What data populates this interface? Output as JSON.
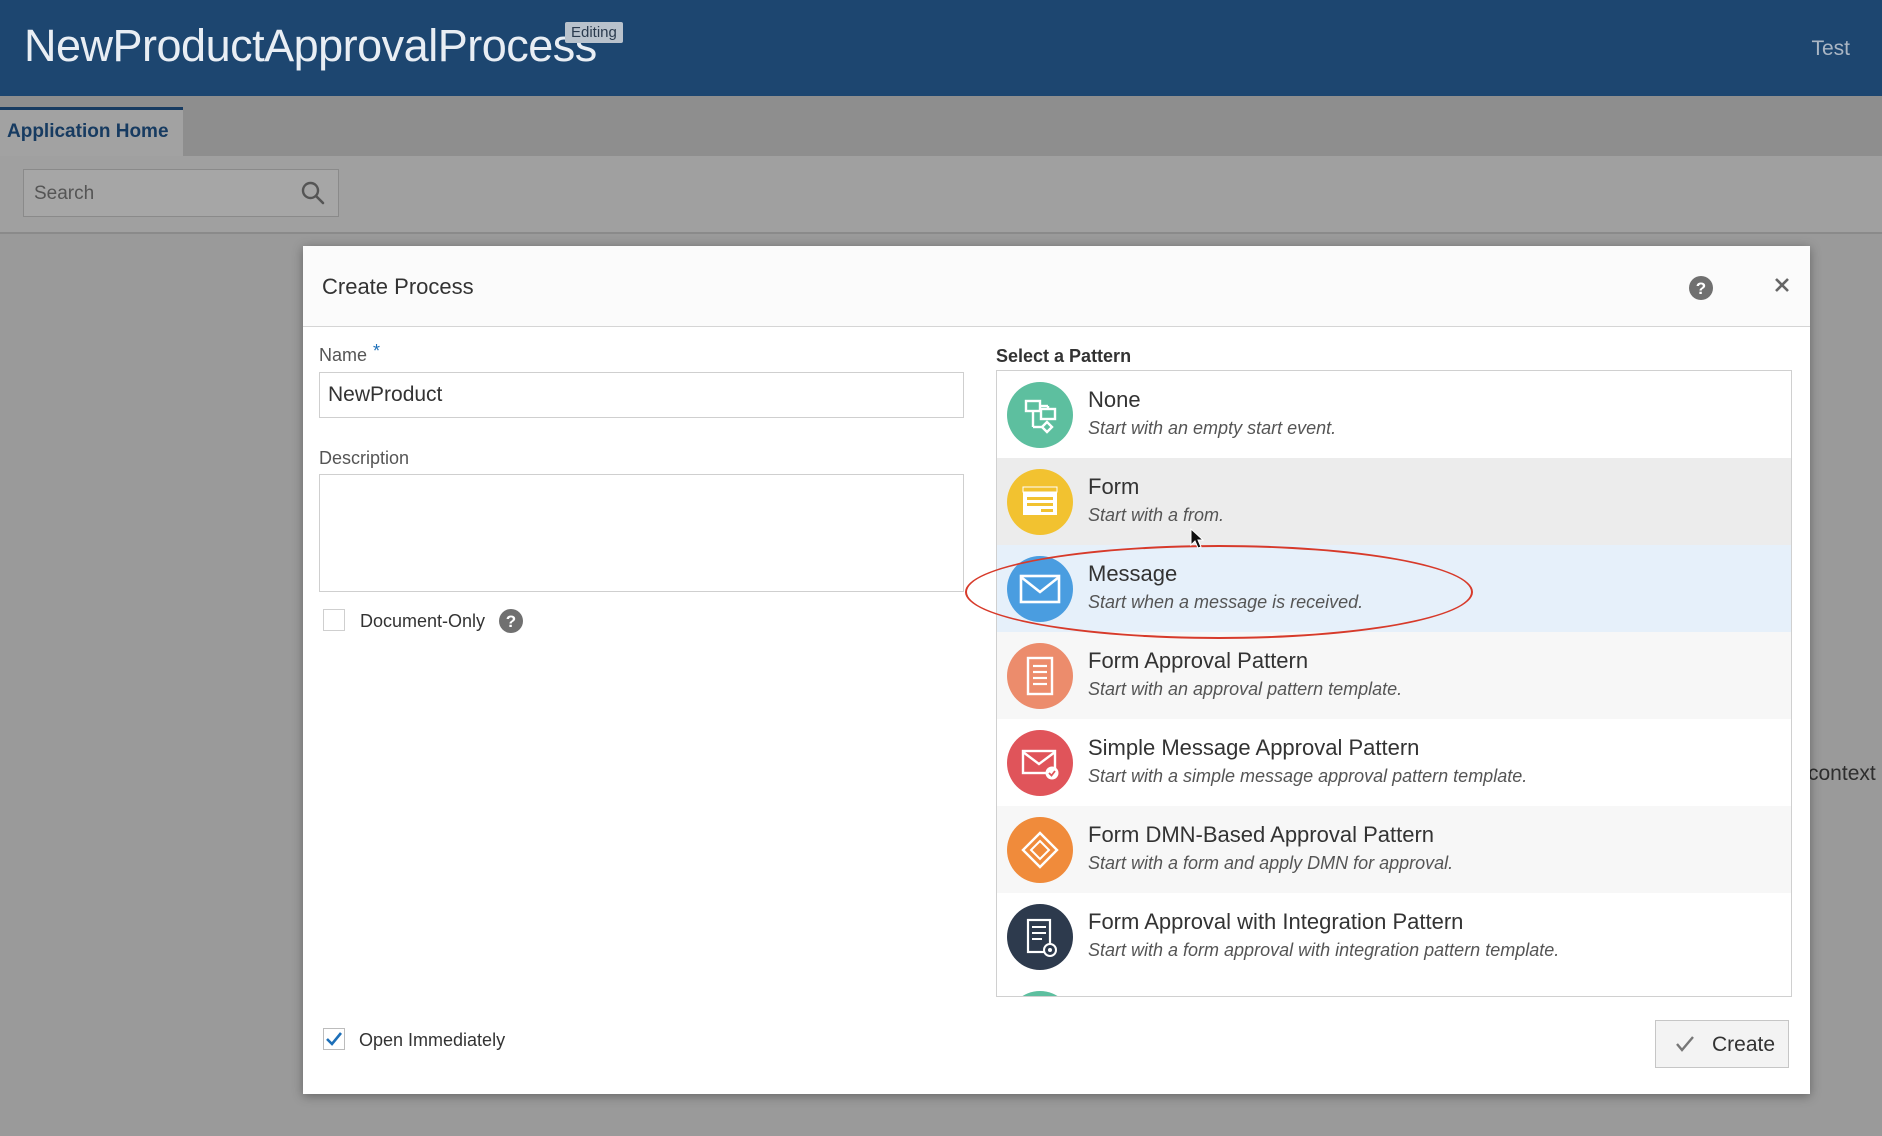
{
  "header": {
    "app_title": "NewProductApprovalProcess",
    "status_badge": "Editing",
    "user": "Test"
  },
  "tabs": [
    {
      "label": "Application Home",
      "active": true
    }
  ],
  "search": {
    "placeholder": "Search"
  },
  "background_text": "context",
  "dialog": {
    "title": "Create Process",
    "name_label": "Name",
    "name_value": "NewProduct",
    "description_label": "Description",
    "description_value": "",
    "document_only_label": "Document-Only",
    "document_only_checked": false,
    "open_immediately_label": "Open Immediately",
    "open_immediately_checked": true,
    "pattern_heading": "Select a Pattern",
    "patterns": [
      {
        "title": "None",
        "desc": "Start with an empty start event.",
        "icon": "flow-diagram-icon",
        "color": "#5dbf9f",
        "state": "normal"
      },
      {
        "title": "Form",
        "desc": "Start with a from.",
        "icon": "form-icon",
        "color": "#f2c230",
        "state": "hover"
      },
      {
        "title": "Message",
        "desc": "Start when a message is received.",
        "icon": "envelope-icon",
        "color": "#4a9de0",
        "state": "selected"
      },
      {
        "title": "Form Approval Pattern",
        "desc": "Start with an approval pattern template.",
        "icon": "document-list-icon",
        "color": "#ec8c6c",
        "state": "normal"
      },
      {
        "title": "Simple Message Approval Pattern",
        "desc": "Start with a simple message approval pattern template.",
        "icon": "envelope-check-icon",
        "color": "#e0545a",
        "state": "normal"
      },
      {
        "title": "Form DMN-Based Approval Pattern",
        "desc": "Start with a form and apply DMN for approval.",
        "icon": "diamond-decision-icon",
        "color": "#f08b3b",
        "state": "normal"
      },
      {
        "title": "Form Approval with Integration Pattern",
        "desc": "Start with a form approval with integration pattern template.",
        "icon": "document-gear-icon",
        "color": "#2d3a4d",
        "state": "normal"
      }
    ],
    "create_label": "Create"
  }
}
